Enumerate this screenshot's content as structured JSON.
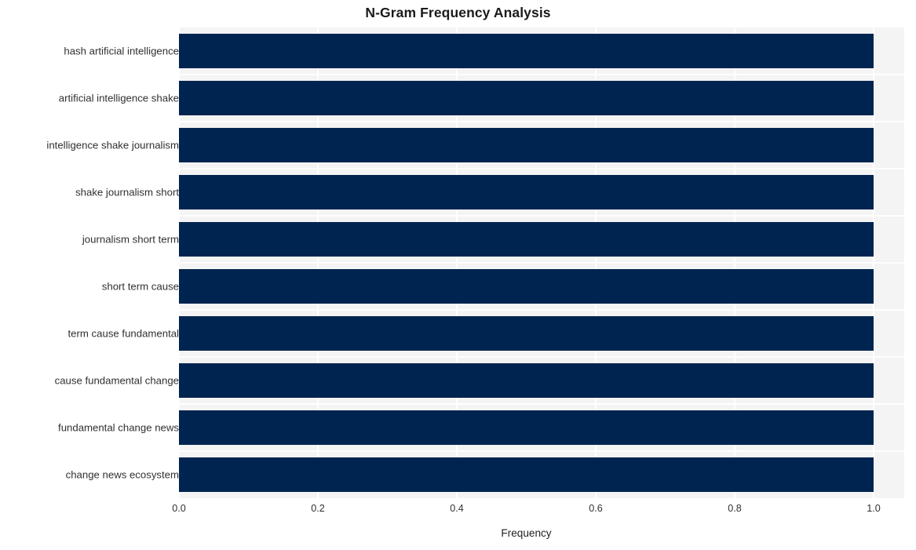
{
  "chart_data": {
    "type": "bar",
    "orientation": "horizontal",
    "title": "N-Gram Frequency Analysis",
    "xlabel": "Frequency",
    "ylabel": "",
    "categories": [
      "hash artificial intelligence",
      "artificial intelligence shake",
      "intelligence shake journalism",
      "shake journalism short",
      "journalism short term",
      "short term cause",
      "term cause fundamental",
      "cause fundamental change",
      "fundamental change news",
      "change news ecosystem"
    ],
    "values": [
      1.0,
      1.0,
      1.0,
      1.0,
      1.0,
      1.0,
      1.0,
      1.0,
      1.0,
      1.0
    ],
    "xticks": [
      0.0,
      0.2,
      0.4,
      0.6,
      0.8,
      1.0
    ],
    "xtick_labels": [
      "0.0",
      "0.2",
      "0.4",
      "0.6",
      "0.8",
      "1.0"
    ],
    "xlim": [
      0.0,
      1.044
    ],
    "grid": true,
    "legend": null,
    "bar_color": "#002450",
    "plot_background": "#f4f4f4",
    "figure_background": "#ffffff",
    "gridline_color": "#ffffff",
    "text_color": "#303030",
    "title_color": "#1a1a1a"
  }
}
